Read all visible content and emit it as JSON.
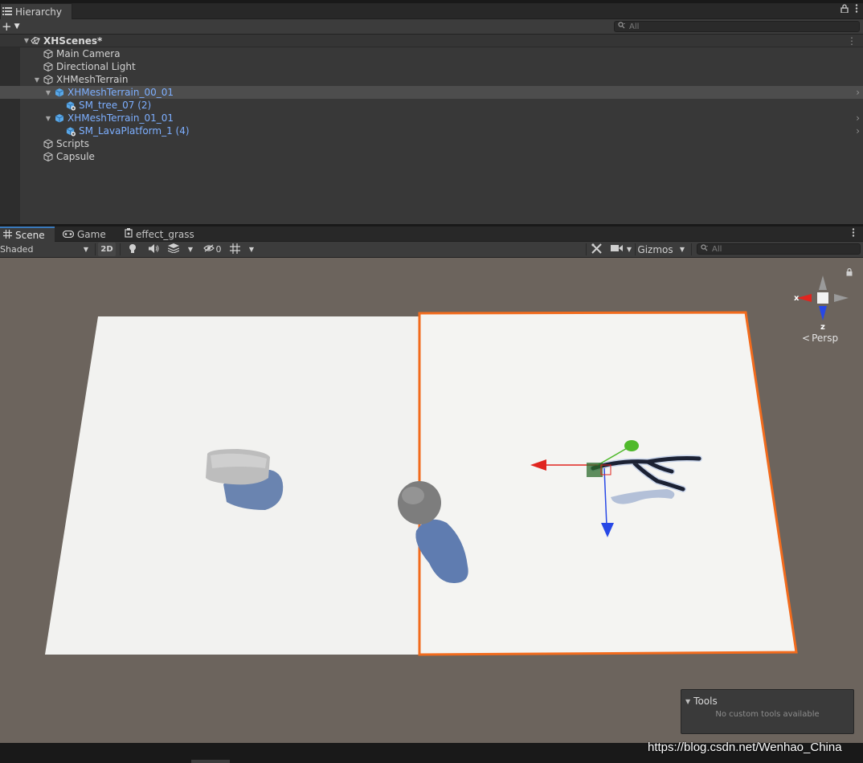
{
  "hierarchy": {
    "tab_label": "Hierarchy",
    "search_placeholder": "All",
    "scene_name": "XHScenes*",
    "items": [
      {
        "label": "Main Camera"
      },
      {
        "label": "Directional Light"
      },
      {
        "label": "XHMeshTerrain"
      },
      {
        "label": "XHMeshTerrain_00_01"
      },
      {
        "label": "SM_tree_07 (2)"
      },
      {
        "label": "XHMeshTerrain_01_01"
      },
      {
        "label": "SM_LavaPlatform_1 (4)"
      },
      {
        "label": "Scripts"
      },
      {
        "label": "Capsule"
      }
    ]
  },
  "scene_view": {
    "tabs": [
      {
        "label": "Scene"
      },
      {
        "label": "Game"
      },
      {
        "label": "effect_grass"
      }
    ],
    "shading_mode": "Shaded",
    "mode_2d": "2D",
    "hidden_count": "0",
    "gizmos_label": "Gizmos",
    "search_placeholder": "All",
    "projection_label": "Persp",
    "axis_x": "x",
    "axis_z": "z"
  },
  "tools_overlay": {
    "title": "Tools",
    "message": "No custom tools available"
  },
  "watermark": "https://blog.csdn.net/Wenhao_China",
  "colors": {
    "selection_outline": "#f26b1d",
    "prefab_blue": "#7dafff",
    "tab_accent": "#3a79bb",
    "viewport_bg": "#6c645d",
    "gizmo_x": "#e0251f",
    "gizmo_y": "#4fb92b",
    "gizmo_z": "#2748e6"
  }
}
